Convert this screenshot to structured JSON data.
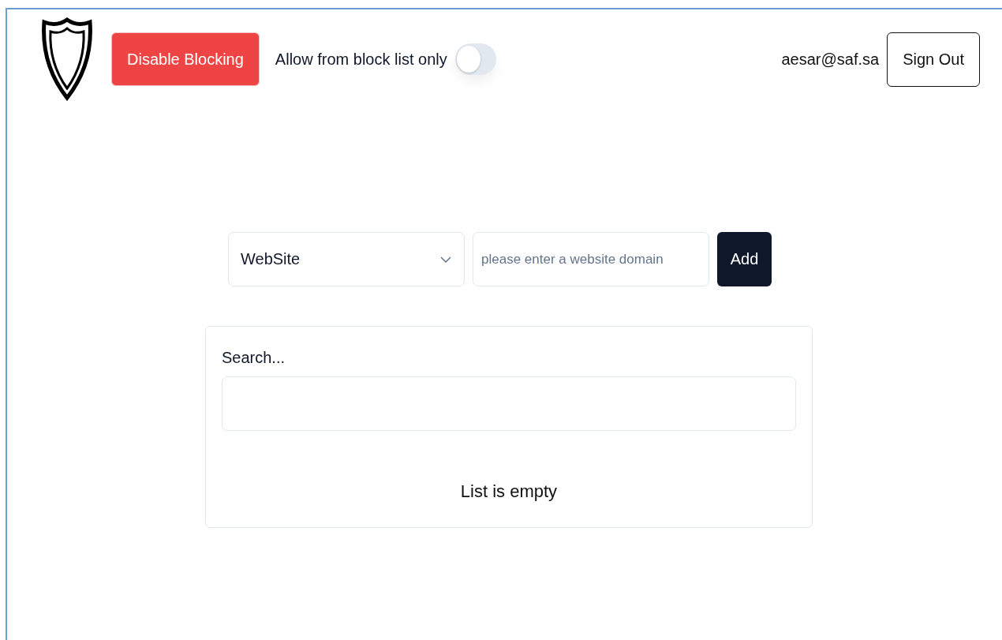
{
  "header": {
    "disable_button": "Disable Blocking",
    "toggle": {
      "label": "Allow from block list only",
      "on": false
    },
    "user_email": "aesar@saf.sa",
    "sign_out_button": "Sign Out"
  },
  "add_form": {
    "type_select": {
      "value": "WebSite"
    },
    "domain_field": {
      "placeholder": "please enter a website domain"
    },
    "add_button": "Add"
  },
  "list_panel": {
    "search_label": "Search...",
    "empty_message": "List is empty"
  }
}
